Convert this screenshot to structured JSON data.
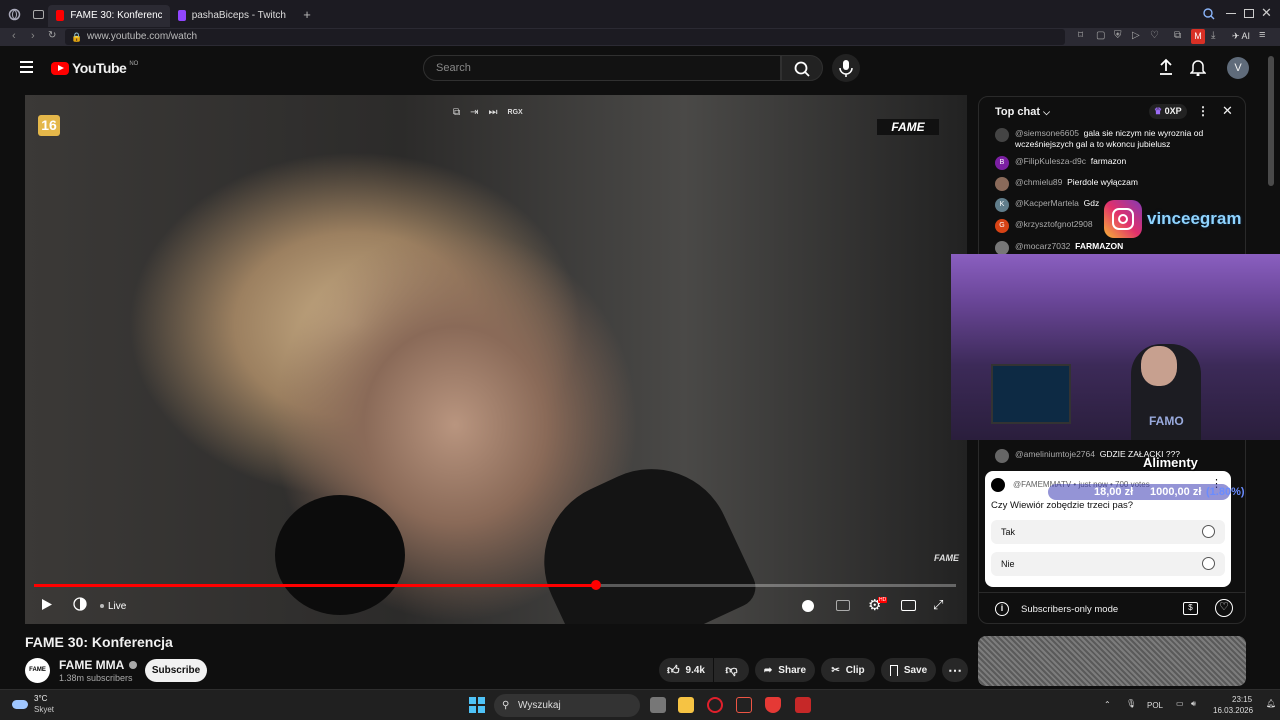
{
  "browser": {
    "tabs": [
      {
        "label": "FAME 30: Konferencja - Yo",
        "active": true
      },
      {
        "label": "pashaBiceps - Twitch",
        "active": false
      }
    ],
    "url": "www.youtube.com/watch",
    "ai_label": "AI"
  },
  "youtube": {
    "logo": "YouTube",
    "region": "NO",
    "search_placeholder": "Search",
    "avatar_letter": "V"
  },
  "player": {
    "age_badge": "16",
    "brand_watermark": "FAME",
    "brand_small": "FAME",
    "progress_fraction": 0.61,
    "live_label": "Live",
    "top_label": "RGX",
    "settings_badge": "HD"
  },
  "video": {
    "title": "FAME 30: Konferencja",
    "channel": "FAME MMA",
    "channel_avatar_text": "FAME",
    "subscribers": "1.38m subscribers",
    "subscribe_label": "Subscribe",
    "likes": "9.4k",
    "share_label": "Share",
    "clip_label": "Clip",
    "save_label": "Save"
  },
  "chat": {
    "header": "Top chat",
    "points": "0XP",
    "messages": [
      {
        "author": "@siemsone6605",
        "text": "gala sie niczym nie wyroznia od wcześniejszych gal a to wkoncu jubielusz",
        "avatar": "",
        "color": "#444"
      },
      {
        "author": "@FilipKulesza-d9c",
        "text": "farmazon",
        "avatar": "B",
        "color": "#7b1fa2"
      },
      {
        "author": "@chmielu89",
        "text": "Pierdole wyłączam",
        "avatar": "",
        "color": "#8a6a5a"
      },
      {
        "author": "@KacperMartela",
        "text": "Gdz",
        "avatar": "K",
        "color": "#607d8b"
      },
      {
        "author": "@krzysztofgnot2908",
        "text": "",
        "avatar": "G",
        "color": "#d84315"
      },
      {
        "author": "@mocarz7032",
        "text": "FARMAZON",
        "avatar": "",
        "color": "#777"
      },
      {
        "author": "@ameliniumtoje2764",
        "text": "GDZIE ZAŁĄCKI ???",
        "avatar": "",
        "color": "#666"
      }
    ],
    "poll": {
      "meta": "@FAMEMMATV • just now • 700 votes",
      "question": "Czy Wiewiór zobędzie trzeci pas?",
      "options": [
        "Tak",
        "Nie"
      ]
    },
    "footer": "Subscribers-only mode"
  },
  "overlay": {
    "instagram_handle": "vinceegram",
    "alimenty_label": "Alimenty",
    "donation_current": "18,00 zł",
    "donation_goal": "1000,00 zł",
    "donation_percent": "(1.80%)",
    "webcam_shirt_text": "FAMO"
  },
  "taskbar": {
    "weather_temp": "3°C",
    "weather_desc": "Skyet",
    "search_label": "Wyszukaj",
    "language": "POL",
    "time": "23:15",
    "date": "16.03.2026"
  }
}
